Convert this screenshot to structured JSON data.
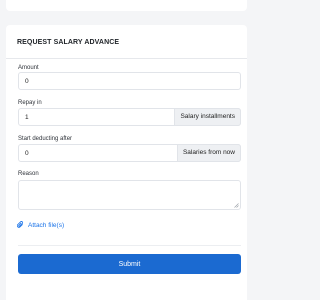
{
  "form": {
    "title": "REQUEST SALARY ADVANCE",
    "amount": {
      "label": "Amount",
      "value": "0"
    },
    "repay": {
      "label": "Repay in",
      "value": "1",
      "suffix": "Salary installments"
    },
    "start": {
      "label": "Start deducting after",
      "value": "0",
      "suffix": "Salaries from now"
    },
    "reason": {
      "label": "Reason",
      "value": ""
    },
    "attach_label": "Attach file(s)",
    "submit_label": "Submit"
  },
  "colors": {
    "accent": "#1b6ad1",
    "link": "#1a73e8",
    "page_background": "#f4f5f7"
  }
}
